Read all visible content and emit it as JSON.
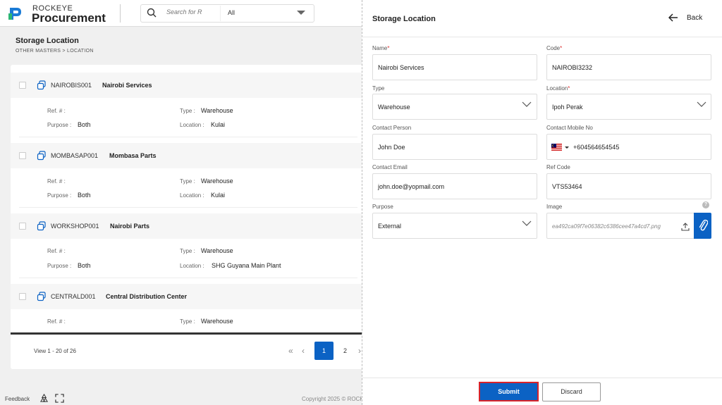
{
  "header": {
    "brand_small": "ROCKEYE",
    "brand_big": "Procurement",
    "search_placeholder": "Search for R",
    "search_filter": "All"
  },
  "page": {
    "title": "Storage Location",
    "breadcrumb": "OTHER MASTERS >  LOCATION"
  },
  "records": [
    {
      "code": "NAIROBIS001",
      "name": "Nairobi Services",
      "ref_label": "Ref. # :",
      "ref": "",
      "purpose_label": "Purpose :",
      "purpose": "Both",
      "type_label": "Type :",
      "type": "Warehouse",
      "location_label": "Location :",
      "location": "Kulai"
    },
    {
      "code": "MOMBASAP001",
      "name": "Mombasa Parts",
      "ref_label": "Ref. # :",
      "ref": "",
      "purpose_label": "Purpose :",
      "purpose": "Both",
      "type_label": "Type :",
      "type": "Warehouse",
      "location_label": "Location :",
      "location": "Kulai"
    },
    {
      "code": "WORKSHOP001",
      "name": "Nairobi Parts",
      "ref_label": "Ref. # :",
      "ref": "",
      "purpose_label": "Purpose :",
      "purpose": "Both",
      "type_label": "Type :",
      "type": "Warehouse",
      "location_label": "Location :",
      "location": "SHG Guyana Main Plant"
    },
    {
      "code": "CENTRALD001",
      "name": "Central Distribution Center",
      "ref_label": "Ref. # :",
      "ref": "",
      "type_label": "Type :",
      "type": "Warehouse"
    }
  ],
  "pagination": {
    "view_info": "View 1 - 20 of 26",
    "first": "«",
    "prev": "‹",
    "next": "›",
    "page_active": "1",
    "page_2": "2"
  },
  "footer": {
    "feedback": "Feedback",
    "copyright": "Copyright 2025 © ROCK"
  },
  "drawer": {
    "title": "Storage Location",
    "back_label": "Back",
    "fields": {
      "name_label": "Name",
      "name_value": "Nairobi Services",
      "code_label": "Code",
      "code_value": "NAIROBI3232",
      "type_label": "Type",
      "type_value": "Warehouse",
      "location_label": "Location",
      "location_value": "Ipoh  Perak",
      "contact_person_label": "Contact Person",
      "contact_person_value": "John Doe",
      "contact_mobile_label": "Contact Mobile No",
      "contact_mobile_value": "+604564654545",
      "contact_email_label": "Contact Email",
      "contact_email_value": "john.doe@yopmail.com",
      "ref_code_label": "Ref Code",
      "ref_code_value": "VTS53464",
      "purpose_label": "Purpose",
      "purpose_value": "External",
      "image_label": "Image",
      "image_value": "ea492ca09f7e06382c6386cee47a4cd7.png",
      "required_mark": "*",
      "help": "?"
    },
    "submit_label": "Submit",
    "discard_label": "Discard"
  },
  "colors": {
    "accent": "#0b62c4",
    "highlight_border": "#d8232a"
  },
  "icons": [
    "logo-icon",
    "search-icon",
    "chevron-down-icon",
    "copy-icon",
    "back-arrow-icon",
    "malaysia-flag-icon",
    "upload-icon",
    "paperclip-icon",
    "help-icon",
    "recycle-icon",
    "expand-icon"
  ]
}
